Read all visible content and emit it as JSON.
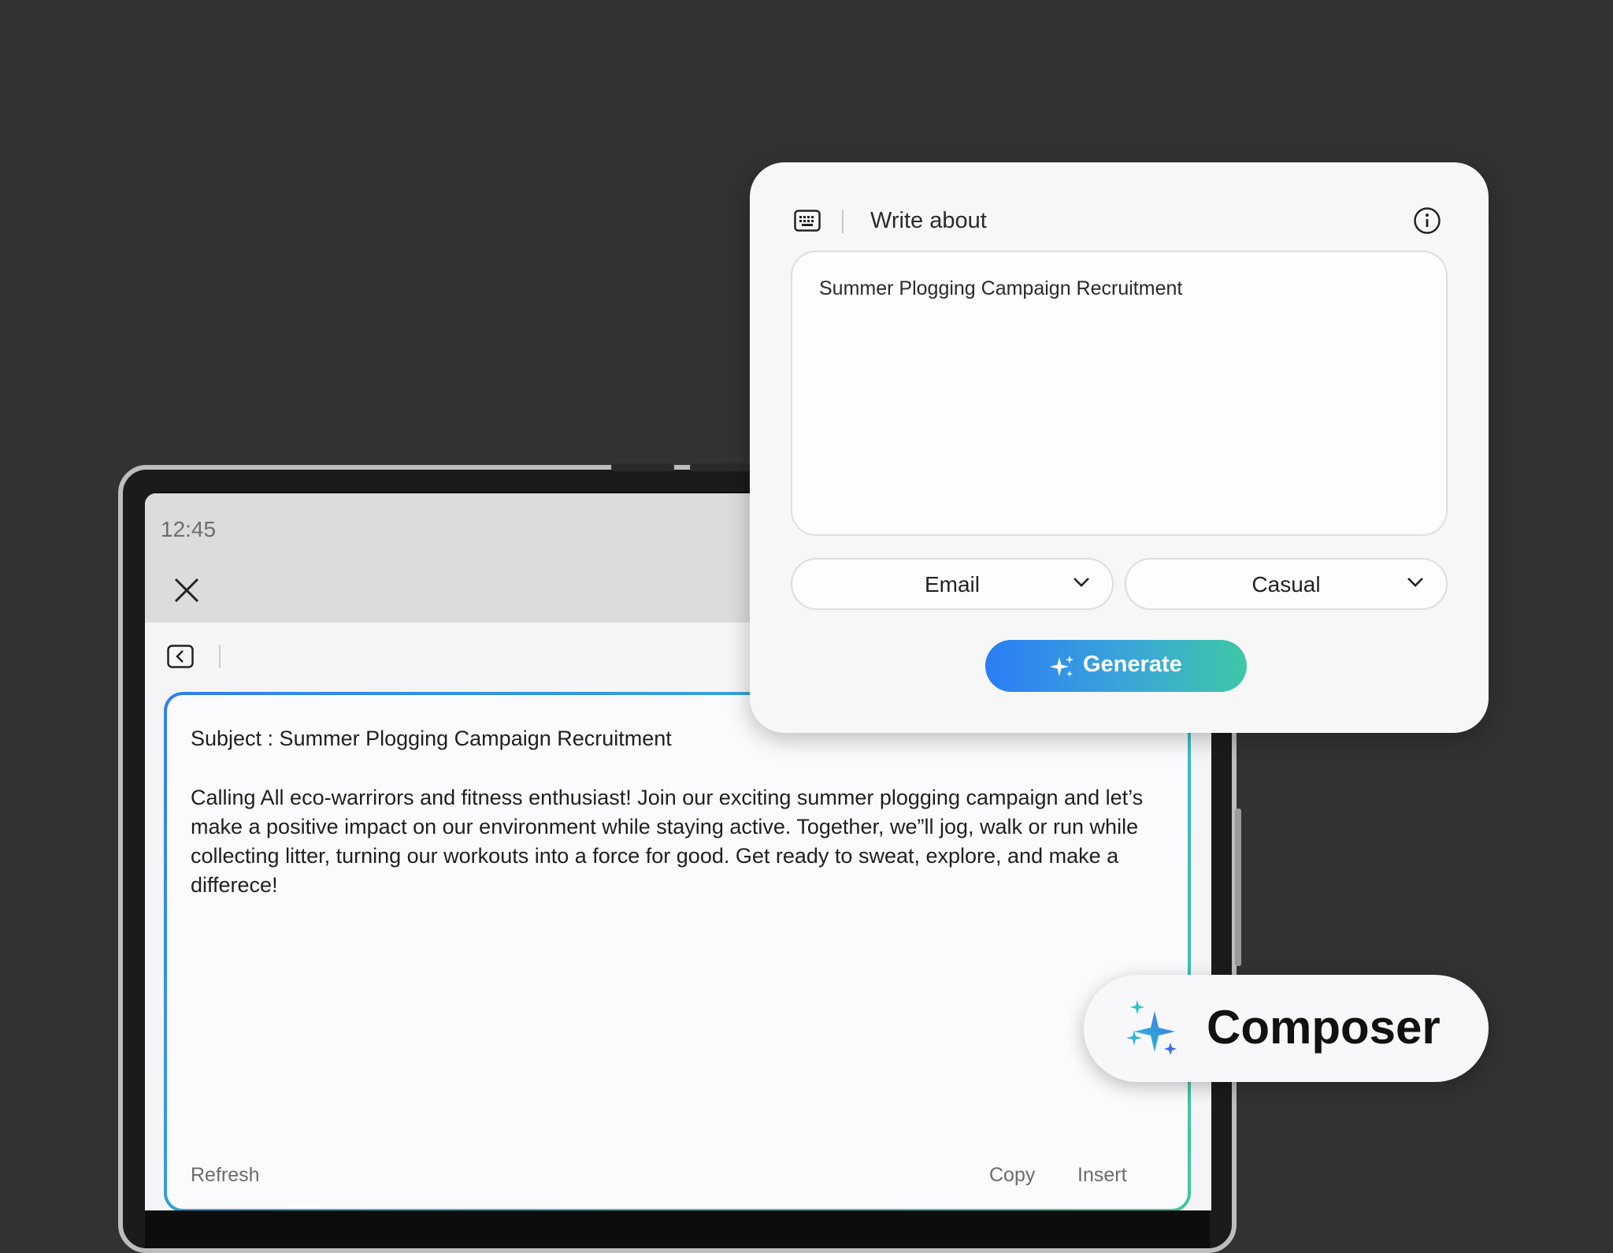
{
  "device": {
    "status_time": "12:45"
  },
  "result": {
    "subject": "Subject : Summer Plogging Campaign Recruitment",
    "body": "Calling All eco-warrirors and fitness enthusiast! Join our exciting summer plogging campaign and let’s make a positive impact on our environment while staying active. Together, we”ll jog, walk or run while collecting litter, turning our workouts into a force for good. Get ready to sweat, explore, and make a differece!",
    "actions": {
      "refresh": "Refresh",
      "copy": "Copy",
      "insert": "Insert"
    }
  },
  "composer_panel": {
    "title": "Write about",
    "prompt_value": "Summer Plogging Campaign Recruitment",
    "format_select": "Email",
    "tone_select": "Casual",
    "generate_label": "Generate"
  },
  "badge": {
    "label": "Composer"
  },
  "icons": {
    "keyboard": "keyboard-icon",
    "info": "info-icon",
    "close": "close-icon",
    "back": "back-icon",
    "sparkle": "sparkle-icon",
    "chevron": "chevron-down-icon"
  },
  "colors": {
    "background": "#323232",
    "gradient_start": "#2b7df5",
    "gradient_end": "#3fc7a6"
  }
}
